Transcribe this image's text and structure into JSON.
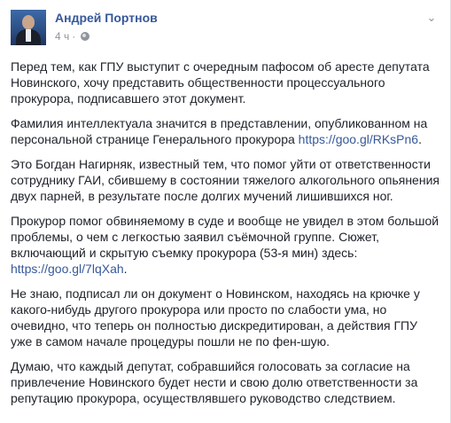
{
  "post": {
    "author": "Андрей Портнов",
    "time": "4 ч",
    "separator": "·",
    "menu_icon": "chevron-down-icon",
    "privacy_icon": "globe-icon",
    "paragraphs": [
      {
        "text": "Перед тем, как ГПУ выступит с очередным пафосом об аресте депутата Новинского, хочу представить общественности процессуального прокурора, подписавшего этот документ."
      },
      {
        "text": "Фамилия интеллектуала значится в представлении, опубликованном на персональной странице Генерального прокурора ",
        "link": "https://goo.gl/RKsPn6",
        "after": "."
      },
      {
        "text": "Это Богдан Нагирняк, известный тем, что помог уйти от ответственности сотруднику ГАИ, сбившему в состоянии тяжелого алкогольного опьянения двух парней, в результате после долгих мучений лишившихся ног."
      },
      {
        "text": "Прокурор помог обвиняемому в суде и вообще не увидел в этом большой проблемы, о чем с легкостью заявил съёмочной группе. Сюжет, включающий и скрытую съемку прокурора (53-я мин) здесь: ",
        "link": "https://goo.gl/7lqXah",
        "after": "."
      },
      {
        "text": "Не знаю, подписал ли он документ о Новинском, находясь на крючке у какого-нибудь другого прокурора или просто по слабости ума, но очевидно, что теперь он полностью дискредитирован, а действия ГПУ уже в самом начале процедуры пошли не по фен-шую."
      },
      {
        "text": "Думаю, что каждый депутат, собравшийся голосовать за согласие на привлечение Новинского будет нести и свою долю ответственности за репутацию прокурора, осуществлявшего руководство следствием."
      }
    ]
  }
}
